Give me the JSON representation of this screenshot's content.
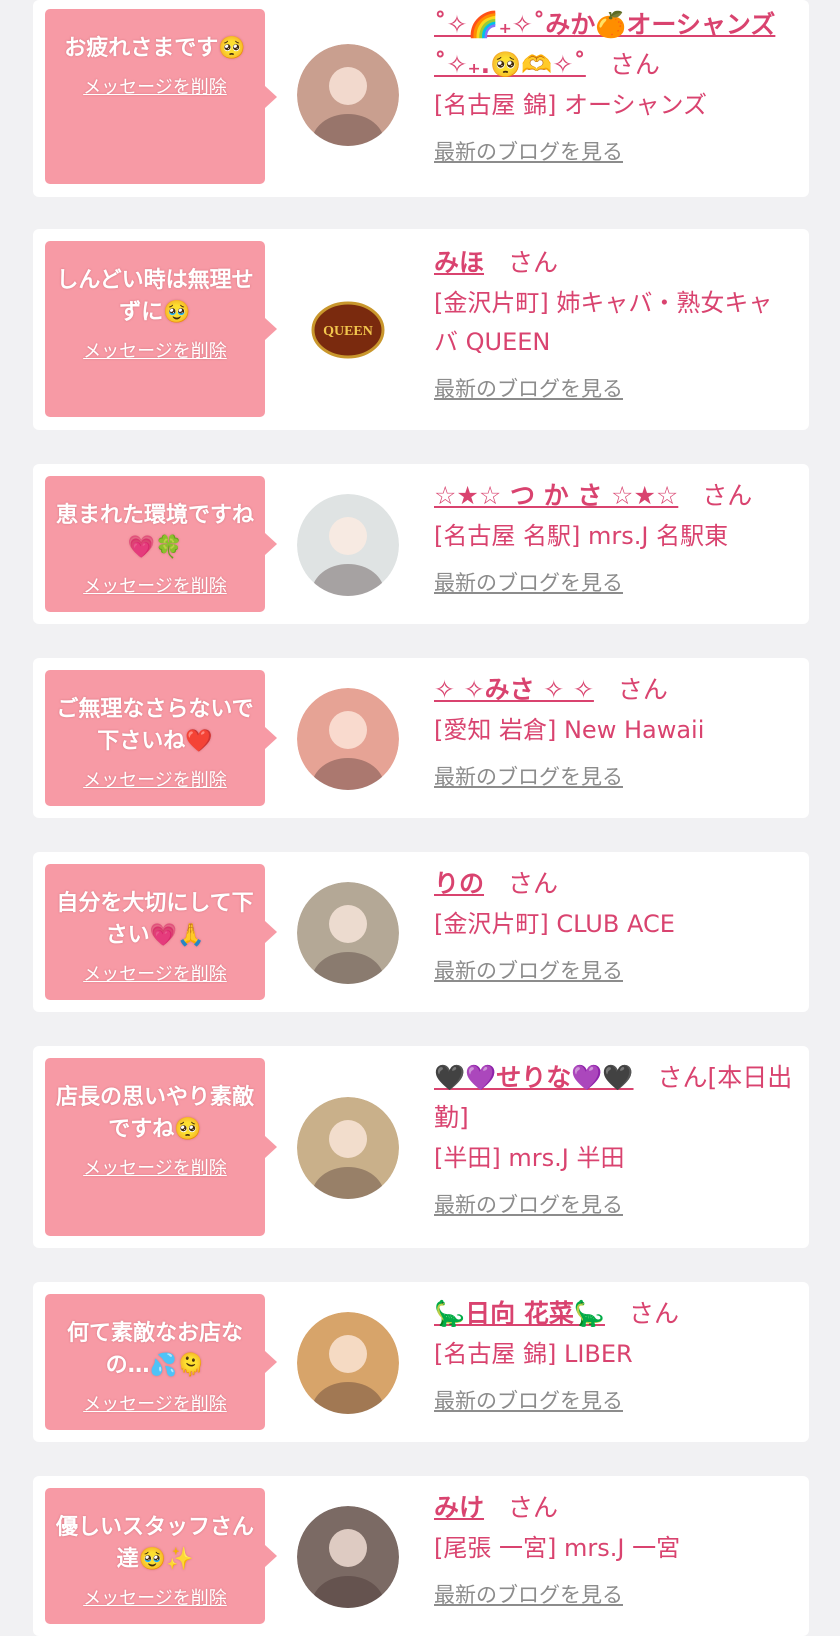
{
  "colors": {
    "background": "#f1f1f3",
    "card": "#ffffff",
    "bubble": "#f79aa5",
    "accent": "#d9436f",
    "link_gray": "#8c8c8c"
  },
  "cards": [
    {
      "message": "お疲れさまです🥺",
      "delete_label": "メッセージを削除",
      "name": "˚✧🌈₊✧˚みか🍊オーシャンズ˚✧₊.🥺🫶✧˚",
      "suffix": "さん",
      "shop": "[名古屋 錦] オーシャンズ",
      "blog_label": "最新のブログを見る",
      "avatar_icon": "avatar-photo",
      "avatar_color": "#c99f8f"
    },
    {
      "message": "しんどい時は無理せずに🥹",
      "delete_label": "メッセージを削除",
      "name": "みほ",
      "suffix": "さん",
      "shop": "[金沢片町] 姉キャバ・熟女キャバ QUEEN",
      "blog_label": "最新のブログを見る",
      "avatar_icon": "queen-logo",
      "avatar_color": "#ffffff",
      "avatar_text": "QUEEN"
    },
    {
      "message": "恵まれた環境ですね💗🍀",
      "delete_label": "メッセージを削除",
      "name": "☆★☆ つ か さ ☆★☆",
      "suffix": "さん",
      "shop": "[名古屋 名駅] mrs.J 名駅東",
      "blog_label": "最新のブログを見る",
      "avatar_icon": "avatar-photo",
      "avatar_color": "#dfe3e3"
    },
    {
      "message": "ご無理なさらないで下さいね❤️",
      "delete_label": "メッセージを削除",
      "name": "✧ ✧みさ ✧ ✧",
      "suffix": "さん",
      "shop": "[愛知 岩倉] New Hawaii",
      "blog_label": "最新のブログを見る",
      "avatar_icon": "avatar-photo",
      "avatar_color": "#e6a395"
    },
    {
      "message": "自分を大切にして下さい💗🙏",
      "delete_label": "メッセージを削除",
      "name": "りの",
      "suffix": "さん",
      "shop": "[金沢片町] CLUB ACE",
      "blog_label": "最新のブログを見る",
      "avatar_icon": "avatar-photo",
      "avatar_color": "#b4a896"
    },
    {
      "message": "店長の思いやり素敵ですね🥺",
      "delete_label": "メッセージを削除",
      "name": "🖤💜せりな💜🖤",
      "suffix": "さん[本日出勤]",
      "shop": "[半田] mrs.J 半田",
      "blog_label": "最新のブログを見る",
      "avatar_icon": "avatar-photo",
      "avatar_color": "#c9b08a"
    },
    {
      "message": "何て素敵なお店なの…💦🫠",
      "delete_label": "メッセージを削除",
      "name": "🦕日向 花菜🦕",
      "suffix": "さん",
      "shop": "[名古屋 錦] LIBER",
      "blog_label": "最新のブログを見る",
      "avatar_icon": "avatar-photo",
      "avatar_color": "#d7a46a"
    },
    {
      "message": "優しいスタッフさん達🥹✨",
      "delete_label": "メッセージを削除",
      "name": "みけ",
      "suffix": "さん",
      "shop": "[尾張 一宮] mrs.J 一宮",
      "blog_label": "最新のブログを見る",
      "avatar_icon": "avatar-photo",
      "avatar_color": "#7b6a64"
    }
  ]
}
